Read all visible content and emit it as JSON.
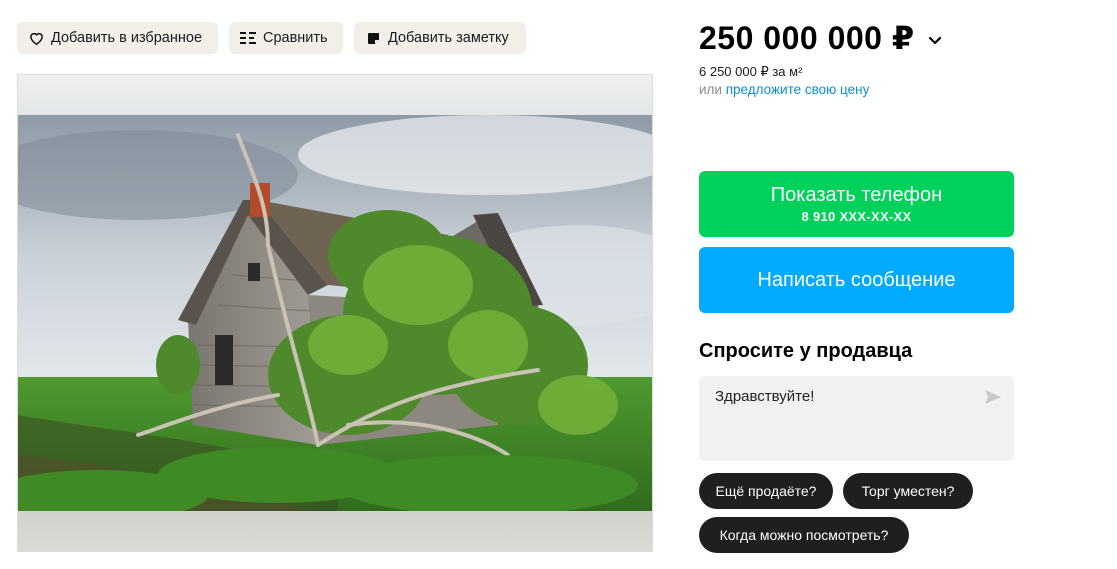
{
  "actions": {
    "favorite_label": "Добавить в избранное",
    "compare_label": "Сравнить",
    "note_label": "Добавить заметку"
  },
  "price": {
    "value": "250 000 000 ₽",
    "per_m2": "6 250 000 ₽ за м²",
    "offer_prefix": "или",
    "offer_link": "предложите свою цену"
  },
  "contact": {
    "phone_label": "Показать телефон",
    "phone_masked": "8 910 XXX-XX-XX",
    "message_label": "Написать сообщение"
  },
  "ask": {
    "title": "Спросите у продавца",
    "message_value": "Здравствуйте!",
    "quick_questions": [
      "Ещё продаёте?",
      "Торг уместен?",
      "Когда можно посмотреть?"
    ]
  },
  "colors": {
    "chip_bg": "#f2efe9",
    "phone_button": "#00d15a",
    "message_button": "#00aaff",
    "link": "#0a8fd6",
    "quick_chip_bg": "#1f1f1f"
  },
  "icons": {
    "favorite": "heart-icon",
    "compare": "compare-icon",
    "note": "note-icon",
    "price_toggle": "chevron-down-icon",
    "send": "send-icon"
  }
}
